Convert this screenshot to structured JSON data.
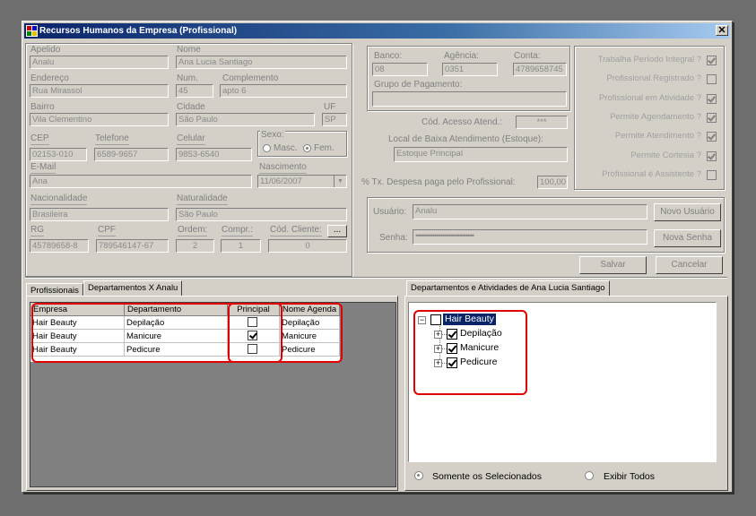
{
  "window": {
    "title": "Recursos Humanos da Empresa (Profissional)",
    "close": "✕"
  },
  "form": {
    "apelido": {
      "label": "Apelido",
      "value": "Analu"
    },
    "nome": {
      "label": "Nome",
      "value": "Ana Lucia Santiago"
    },
    "endereco": {
      "label": "Endereço",
      "value": "Rua Mirassol"
    },
    "num": {
      "label": "Num.",
      "value": "45"
    },
    "complemento": {
      "label": "Complemento",
      "value": "apto 6"
    },
    "bairro": {
      "label": "Bairro",
      "value": "Vila Clementino"
    },
    "cidade": {
      "label": "Cidade",
      "value": "São Paulo"
    },
    "uf": {
      "label": "UF",
      "value": "SP"
    },
    "cep": {
      "label": "CEP",
      "value": "02153-010"
    },
    "telefone": {
      "label": "Telefone",
      "value": "6589-9657"
    },
    "celular": {
      "label": "Celular",
      "value": "9853-6540"
    },
    "sexo": {
      "label": "Sexo:",
      "masc": "Masc.",
      "fem": "Fem.",
      "selected": "Fem."
    },
    "email": {
      "label": "E-Mail",
      "value": "Ana"
    },
    "nascimento": {
      "label": "Nascimento",
      "value": "11/06/2007"
    },
    "nacionalidade": {
      "label": "Nacionalidade",
      "value": "Brasileira"
    },
    "naturalidade": {
      "label": "Naturalidade",
      "value": "São Paulo"
    },
    "rg": {
      "label": "RG",
      "value": "45789658-8"
    },
    "cpf": {
      "label": "CPF",
      "value": "789546147-67"
    },
    "ordem": {
      "label": "Ordem:",
      "value": "2"
    },
    "compr": {
      "label": "Compr.:",
      "value": "1"
    },
    "cod_cliente": {
      "label": "Cód. Cliente:",
      "value": "0",
      "button": "..."
    },
    "banco": {
      "label": "Banco:",
      "value": "08"
    },
    "agencia": {
      "label": "Agência:",
      "value": "0351"
    },
    "conta": {
      "label": "Conta:",
      "value": "4789658745"
    },
    "grupo_pagamento": {
      "label": "Grupo de Pagamento:",
      "value": ""
    },
    "cod_acesso": {
      "label": "Cód. Acesso Atend.:",
      "value": "***"
    },
    "local_baixa": {
      "label": "Local de Baixa Atendimento (Estoque):",
      "value": "Estoque Principal"
    },
    "tx_despesa": {
      "label": "% Tx. Despesa paga pelo Profissional:",
      "value": "100,00"
    },
    "usuario": {
      "label": "Usuário:",
      "value": "Analu",
      "button": "Novo Usuário"
    },
    "senha": {
      "label": "Senha:",
      "value": "••••••••••••••••••••••••••••",
      "button": "Nova Senha"
    }
  },
  "permissions": [
    {
      "label": "Trabalha Período Integral ?",
      "checked": true
    },
    {
      "label": "Profissional Registrado ?",
      "checked": false
    },
    {
      "label": "Profissional em Atividade ?",
      "checked": true
    },
    {
      "label": "Permite Agendamento ?",
      "checked": true
    },
    {
      "label": "Permite Atendimento ?",
      "checked": true
    },
    {
      "label": "Permite Cortesia ?",
      "checked": true
    },
    {
      "label": "Profissional é Assistente ?",
      "checked": false
    }
  ],
  "actions": {
    "salvar": "Salvar",
    "cancelar": "Cancelar"
  },
  "left_tabs": [
    "Profissionais",
    "Departamentos X Analu"
  ],
  "grid": {
    "headers": [
      "Empresa",
      "Departamento",
      "Principal",
      "Nome Agenda"
    ],
    "rows": [
      {
        "empresa": "Hair Beauty",
        "departamento": "Depilação",
        "principal": false,
        "agenda": "Depilação"
      },
      {
        "empresa": "Hair Beauty",
        "departamento": "Manicure",
        "principal": true,
        "agenda": "Manicure"
      },
      {
        "empresa": "Hair Beauty",
        "departamento": "Pedicure",
        "principal": false,
        "agenda": "Pedicure"
      }
    ]
  },
  "right_tab": "Departamentos e Atividades de Ana Lucia Santiago",
  "tree": {
    "root": {
      "label": "Hair Beauty",
      "checked": false,
      "expander": "−"
    },
    "children": [
      {
        "label": "Depilação",
        "checked": true,
        "expander": "+"
      },
      {
        "label": "Manicure",
        "checked": true,
        "expander": "+"
      },
      {
        "label": "Pedicure",
        "checked": true,
        "expander": "+"
      }
    ]
  },
  "filter": {
    "option1": "Somente os Selecionados",
    "option2": "Exibir Todos",
    "selected": "Somente os Selecionados"
  },
  "colors": {
    "highlight": "#e00000",
    "title_start": "#0a246a",
    "selection": "#0a246a"
  }
}
